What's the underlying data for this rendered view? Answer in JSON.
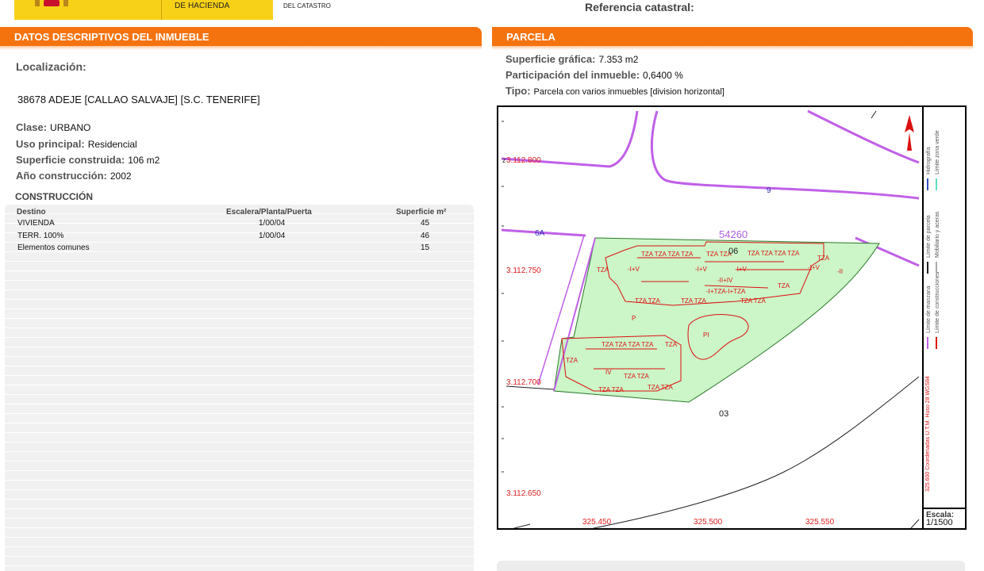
{
  "header": {
    "brand_text": "DE HACIENDA",
    "sub_text": "DEL CATASTRO",
    "ref_title": "Referencia catastral:"
  },
  "left": {
    "section_title": "DATOS DESCRIPTIVOS DEL INMUEBLE",
    "localizacion_label": "Localización:",
    "address": "38678 ADEJE [CALLAO SALVAJE] [S.C. TENERIFE]",
    "fields": [
      {
        "label": "Clase:",
        "value": "URBANO"
      },
      {
        "label": "Uso principal:",
        "value": "Residencial"
      },
      {
        "label": "Superficie construida:",
        "value": "106 m2"
      },
      {
        "label": "Año construcción:",
        "value": "2002"
      }
    ],
    "construccion_title": "CONSTRUCCIÓN",
    "table": {
      "headers": [
        "Destino",
        "Escalera/Planta/Puerta",
        "Superficie m²"
      ],
      "rows": [
        [
          "VIVIENDA",
          "1/00/04",
          "45"
        ],
        [
          "TERR. 100%",
          "1/00/04",
          "46"
        ],
        [
          "Elementos comunes",
          "",
          "15"
        ]
      ]
    }
  },
  "right": {
    "section_title": "PARCELA",
    "fields": [
      {
        "label": "Superficie gráfica:",
        "value": "7.353 m2"
      },
      {
        "label": "Participación del inmueble:",
        "value": "0,6400 %"
      },
      {
        "label": "Tipo:",
        "value": "Parcela con varios inmuebles [division horizontal]"
      }
    ],
    "map": {
      "y_coords": [
        "3.112.800",
        "3.112.750",
        "3.112.700",
        "3.112.650"
      ],
      "x_coords": [
        "325.450",
        "325.500",
        "325.550"
      ],
      "parcel_number": "54260",
      "labels": {
        "block_06": "06",
        "block_03": "03",
        "street_9": "9",
        "street_6a": "6A",
        "pool": "PI",
        "p": "P",
        "iv": "IV",
        "tza": "TZA",
        "v": "-I+V",
        "ii": "-II"
      },
      "legend": {
        "hidrografia": "Hidrografía",
        "zona_verde": "Límite zona verde",
        "parcela": "Límite de parcela",
        "mobiliario": "Mobiliario y aceras",
        "manzana": "Límite de manzana",
        "construcciones": "Límite de construcciones",
        "coords_note": "325.600 Coordenadas U.T.M. Huso 28 WGS84"
      },
      "scale_label": "Escala:",
      "scale_value": "1/1500",
      "colors": {
        "parcel_fill": "#ccf5c8",
        "construction": "#dd1111",
        "block_limit": "#c060e8",
        "coords": "#e02020"
      }
    }
  },
  "colors": {
    "section_header": "#f5730f",
    "brand_yellow": "#f7d117"
  }
}
